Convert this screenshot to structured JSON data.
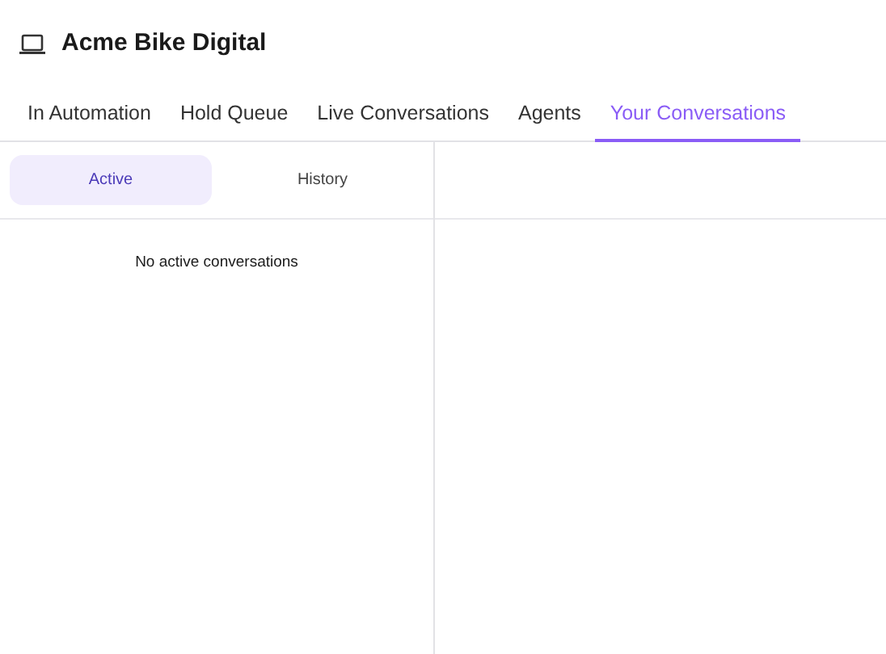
{
  "header": {
    "title": "Acme Bike Digital"
  },
  "tabs": [
    {
      "label": "In Automation",
      "selected": false
    },
    {
      "label": "Hold Queue",
      "selected": false
    },
    {
      "label": "Live Conversations",
      "selected": false
    },
    {
      "label": "Agents",
      "selected": false
    },
    {
      "label": "Your Conversations",
      "selected": true
    }
  ],
  "segments": [
    {
      "label": "Active",
      "selected": true
    },
    {
      "label": "History",
      "selected": false
    }
  ],
  "empty_message": "No active conversations"
}
